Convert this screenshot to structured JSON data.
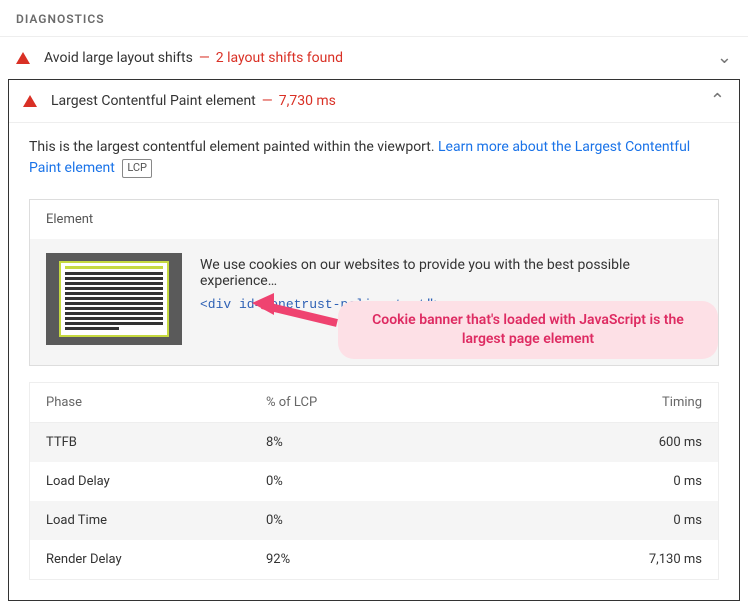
{
  "section_heading": "DIAGNOSTICS",
  "audits": [
    {
      "title": "Avoid large layout shifts",
      "metric": "2 layout shifts found"
    },
    {
      "title": "Largest Contentful Paint element",
      "metric": "7,730 ms"
    }
  ],
  "description": {
    "text": "This is the largest contentful element painted within the viewport. ",
    "link": "Learn more about the Largest Contentful Paint element",
    "badge": "LCP"
  },
  "element_box": {
    "header": "Element",
    "cookie_text": "We use cookies on our websites to provide you with the best possible experience…",
    "snippet": "<div id=\"onetrust-policy-text\">"
  },
  "annotation": "Cookie banner that's loaded with JavaScript is the largest page element",
  "phase_table": {
    "headers": {
      "phase": "Phase",
      "pct": "% of LCP",
      "timing": "Timing"
    },
    "rows": [
      {
        "phase": "TTFB",
        "pct": "8%",
        "timing": "600 ms"
      },
      {
        "phase": "Load Delay",
        "pct": "0%",
        "timing": "0 ms"
      },
      {
        "phase": "Load Time",
        "pct": "0%",
        "timing": "0 ms"
      },
      {
        "phase": "Render Delay",
        "pct": "92%",
        "timing": "7,130 ms"
      }
    ]
  }
}
